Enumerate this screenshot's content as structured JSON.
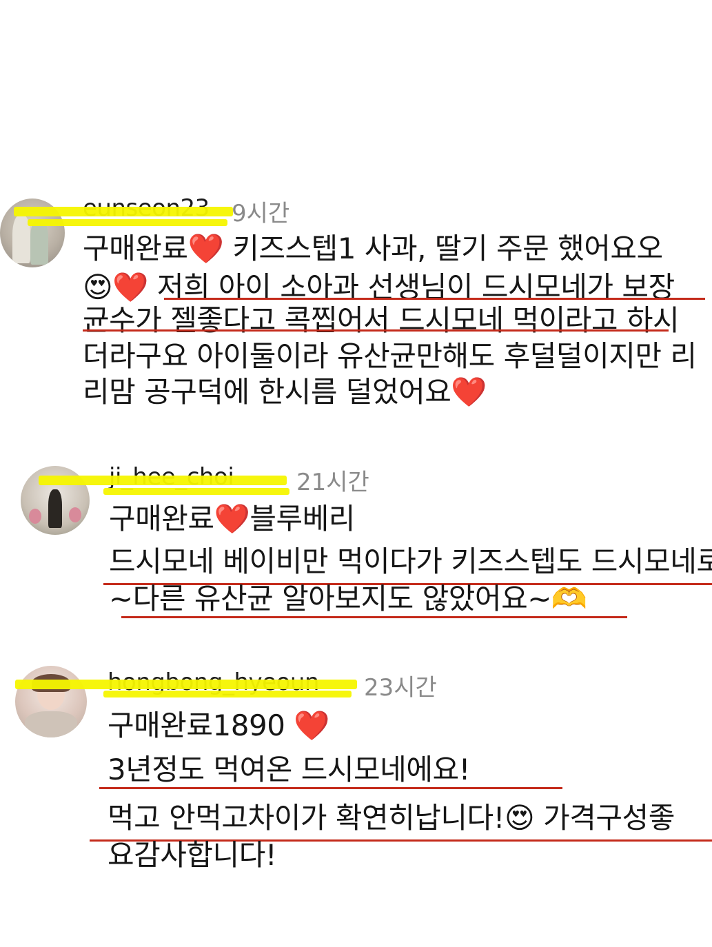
{
  "comments": [
    {
      "username": "eunseon23",
      "time": "9시간",
      "lines": [
        "구매완료❤️ 키즈스텝1  사과, 딸기 주문 했어요오",
        "😍❤️ 저희 아이 소아과 선생님이 드시모네가 보장",
        "균수가 젤좋다고 콕찝어서 드시모네 먹이라고 하시",
        "더라구요 아이둘이라 유산균만해도 후덜덜이지만 리",
        "리맘 공구덕에 한시름 덜었어요❤️"
      ]
    },
    {
      "username": "ji_hee_choi",
      "time": "21시간",
      "lines": [
        "구매완료❤️블루베리",
        "드시모네 베이비만 먹이다가 키즈스텝도 드시모네로",
        "~다른 유산균 알아보지도 않았어요~🫶"
      ]
    },
    {
      "username": "hongbong_hyeoun",
      "time": "23시간",
      "lines": [
        "구매완료1890 ❤️",
        "3년정도 먹여온 드시모네에요!",
        "먹고 안먹고차이가 확연히납니다!😍 가격구성좋",
        "요감사합니다!"
      ]
    }
  ]
}
